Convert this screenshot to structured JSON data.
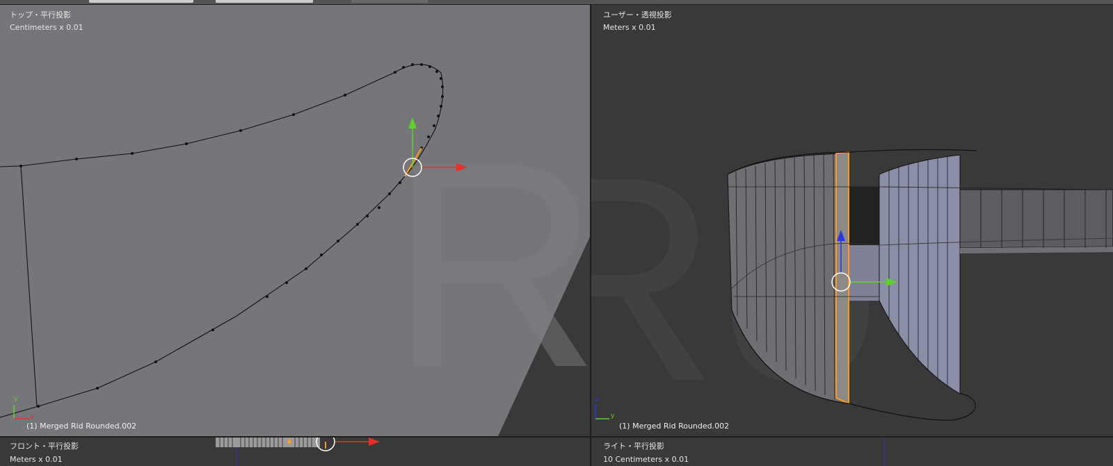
{
  "viewports": {
    "top_left": {
      "view_name": "トップ・平行投影",
      "scale": "Centimeters x 0.01",
      "object_label": "(1) Merged Rid Rounded.002",
      "axes": {
        "x": "x",
        "y": "y"
      }
    },
    "top_right": {
      "view_name": "ユーザー・透視投影",
      "scale": "Meters x 0.01",
      "object_label": "(1) Merged Rid Rounded.002",
      "axes": {
        "y": "y",
        "z": "z"
      }
    },
    "bottom_left": {
      "view_name": "フロント・平行投影",
      "scale": "Meters x 0.01"
    },
    "bottom_right": {
      "view_name": "ライト・平行投影",
      "scale": "10 Centimeters x 0.01"
    }
  },
  "colors": {
    "background": "#3b3b3b",
    "mesh_face": "#767579",
    "selection": "#ff9a1a",
    "axis_x": "#e8302a",
    "axis_y": "#5fd12a",
    "axis_z": "#2a36e8",
    "face_blue": "#8a8ea6"
  }
}
